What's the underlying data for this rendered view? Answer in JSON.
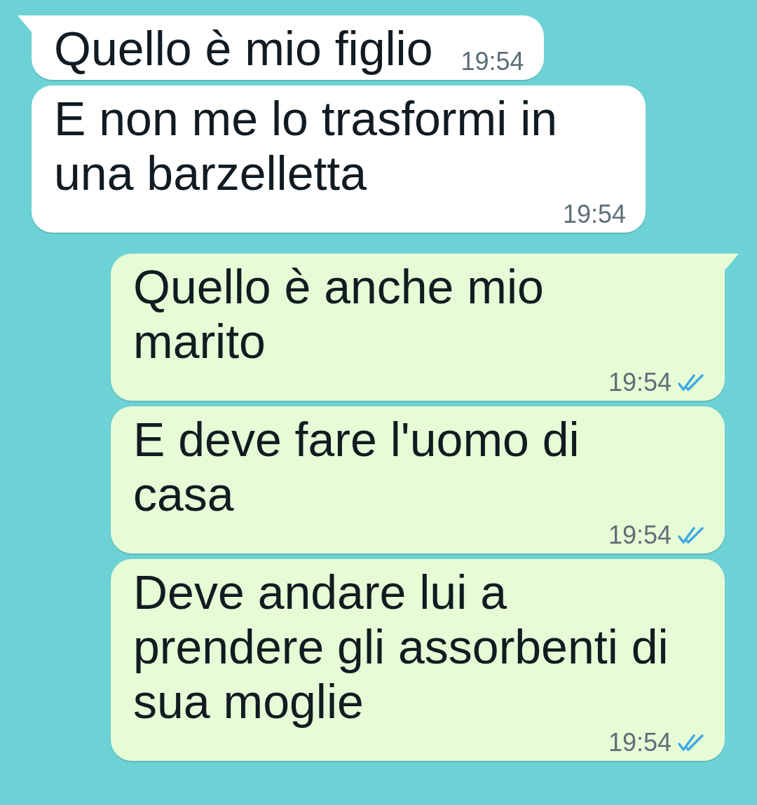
{
  "messages": [
    {
      "kind": "incoming",
      "tail": true,
      "text": "Quello è mio figlio",
      "time": "19:54"
    },
    {
      "kind": "incoming",
      "tail": false,
      "text": "E non me lo trasformi in una barzelletta",
      "time": "19:54"
    },
    {
      "kind": "outgoing",
      "tail": true,
      "text": "Quello è anche mio marito",
      "time": "19:54",
      "read": true
    },
    {
      "kind": "outgoing",
      "tail": false,
      "text": "E deve fare l'uomo di casa",
      "time": "19:54",
      "read": true
    },
    {
      "kind": "outgoing",
      "tail": false,
      "text": "Deve andare lui a prendere gli assorbenti di sua moglie",
      "time": "19:54",
      "read": true
    }
  ]
}
